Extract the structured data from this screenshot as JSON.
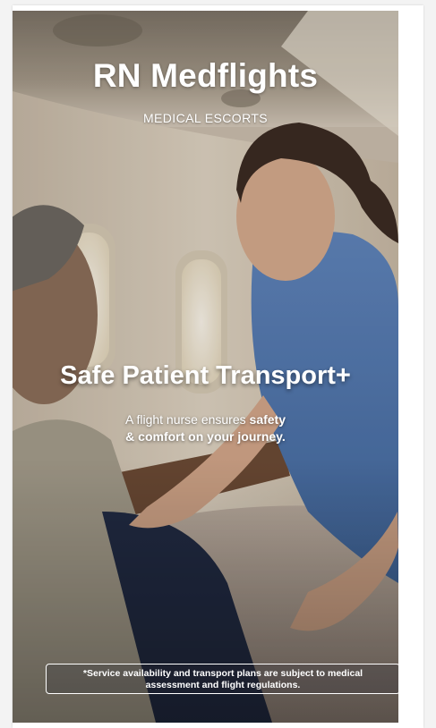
{
  "brand": {
    "title": "RN Medflights",
    "subtitle": "MEDICAL ESCORTS"
  },
  "hero": {
    "headline": "Safe Patient Transport+",
    "tagline_part1": "A flight nurse ensures ",
    "tagline_bold1": "safety",
    "tagline_line2_bold": "& comfort on your journey."
  },
  "disclaimer": {
    "text": "*Service availability and transport plans are subject to medical assessment and flight regulations."
  }
}
